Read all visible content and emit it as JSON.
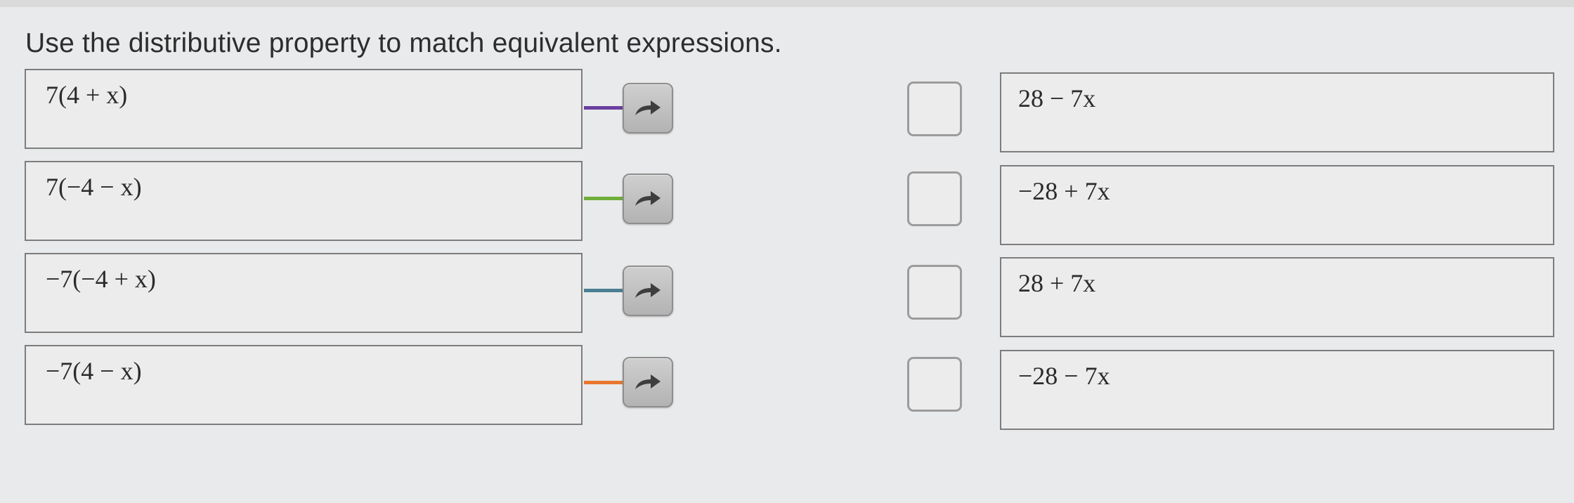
{
  "prompt": "Use the distributive property to match equivalent expressions.",
  "left_items": [
    {
      "expression": "7(4 + x)",
      "connector_color": "#6b3fa0",
      "arrow_icon": "curved-arrow-right-icon"
    },
    {
      "expression": "7(−4 − x)",
      "connector_color": "#6fae3a",
      "arrow_icon": "curved-arrow-right-icon"
    },
    {
      "expression": "−7(−4 + x)",
      "connector_color": "#4a7f94",
      "arrow_icon": "curved-arrow-right-icon"
    },
    {
      "expression": "−7(4 − x)",
      "connector_color": "#e8762d",
      "arrow_icon": "curved-arrow-right-icon"
    }
  ],
  "right_items": [
    {
      "expression": "28 − 7x"
    },
    {
      "expression": "−28 + 7x"
    },
    {
      "expression": "28 + 7x"
    },
    {
      "expression": "−28 − 7x"
    }
  ]
}
